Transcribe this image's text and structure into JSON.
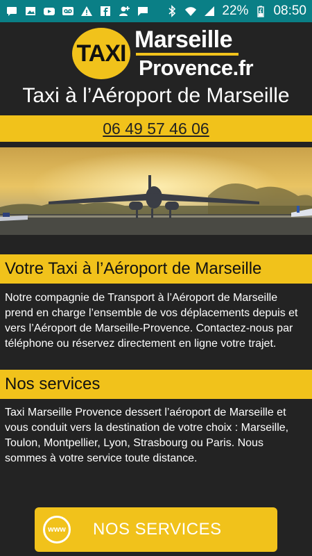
{
  "statusbar": {
    "battery_text": "22%",
    "time": "08:50",
    "left_icons": [
      "message-icon",
      "photo-icon",
      "youtube-icon",
      "voicemail-icon",
      "warning-icon",
      "facebook-icon",
      "add-contact-icon",
      "chat-icon"
    ],
    "right_icons": [
      "bluetooth-icon",
      "wifi-icon",
      "signal-icon",
      "battery-icon"
    ]
  },
  "logo": {
    "badge": "TAXI",
    "line1": "Marseille",
    "line2": "Provence.fr"
  },
  "header": {
    "title": "Taxi à l’Aéroport de Marseille",
    "phone": "06 49 57 46 06"
  },
  "colors": {
    "accent": "#f1c21b",
    "background": "#232323",
    "statusbar": "#0a7f86"
  },
  "sections": [
    {
      "heading": "Votre Taxi à l’Aéroport de Marseille",
      "text": "Notre compagnie de Transport à l’Aéroport de Marseille prend en charge l’ensemble de vos déplacements depuis et vers l’Aéroport de Marseille-Provence. Contactez-nous par téléphone ou réservez directement en ligne votre trajet."
    },
    {
      "heading": "Nos services",
      "text": "Taxi Marseille Provence dessert l’aéroport de Marseille et vous conduit vers la destination de votre choix : Marseille, Toulon, Montpellier, Lyon, Strasbourg ou Paris. Nous sommes à votre service toute distance."
    }
  ],
  "cta": {
    "badge": "www",
    "label": "NOS SERVICES"
  }
}
